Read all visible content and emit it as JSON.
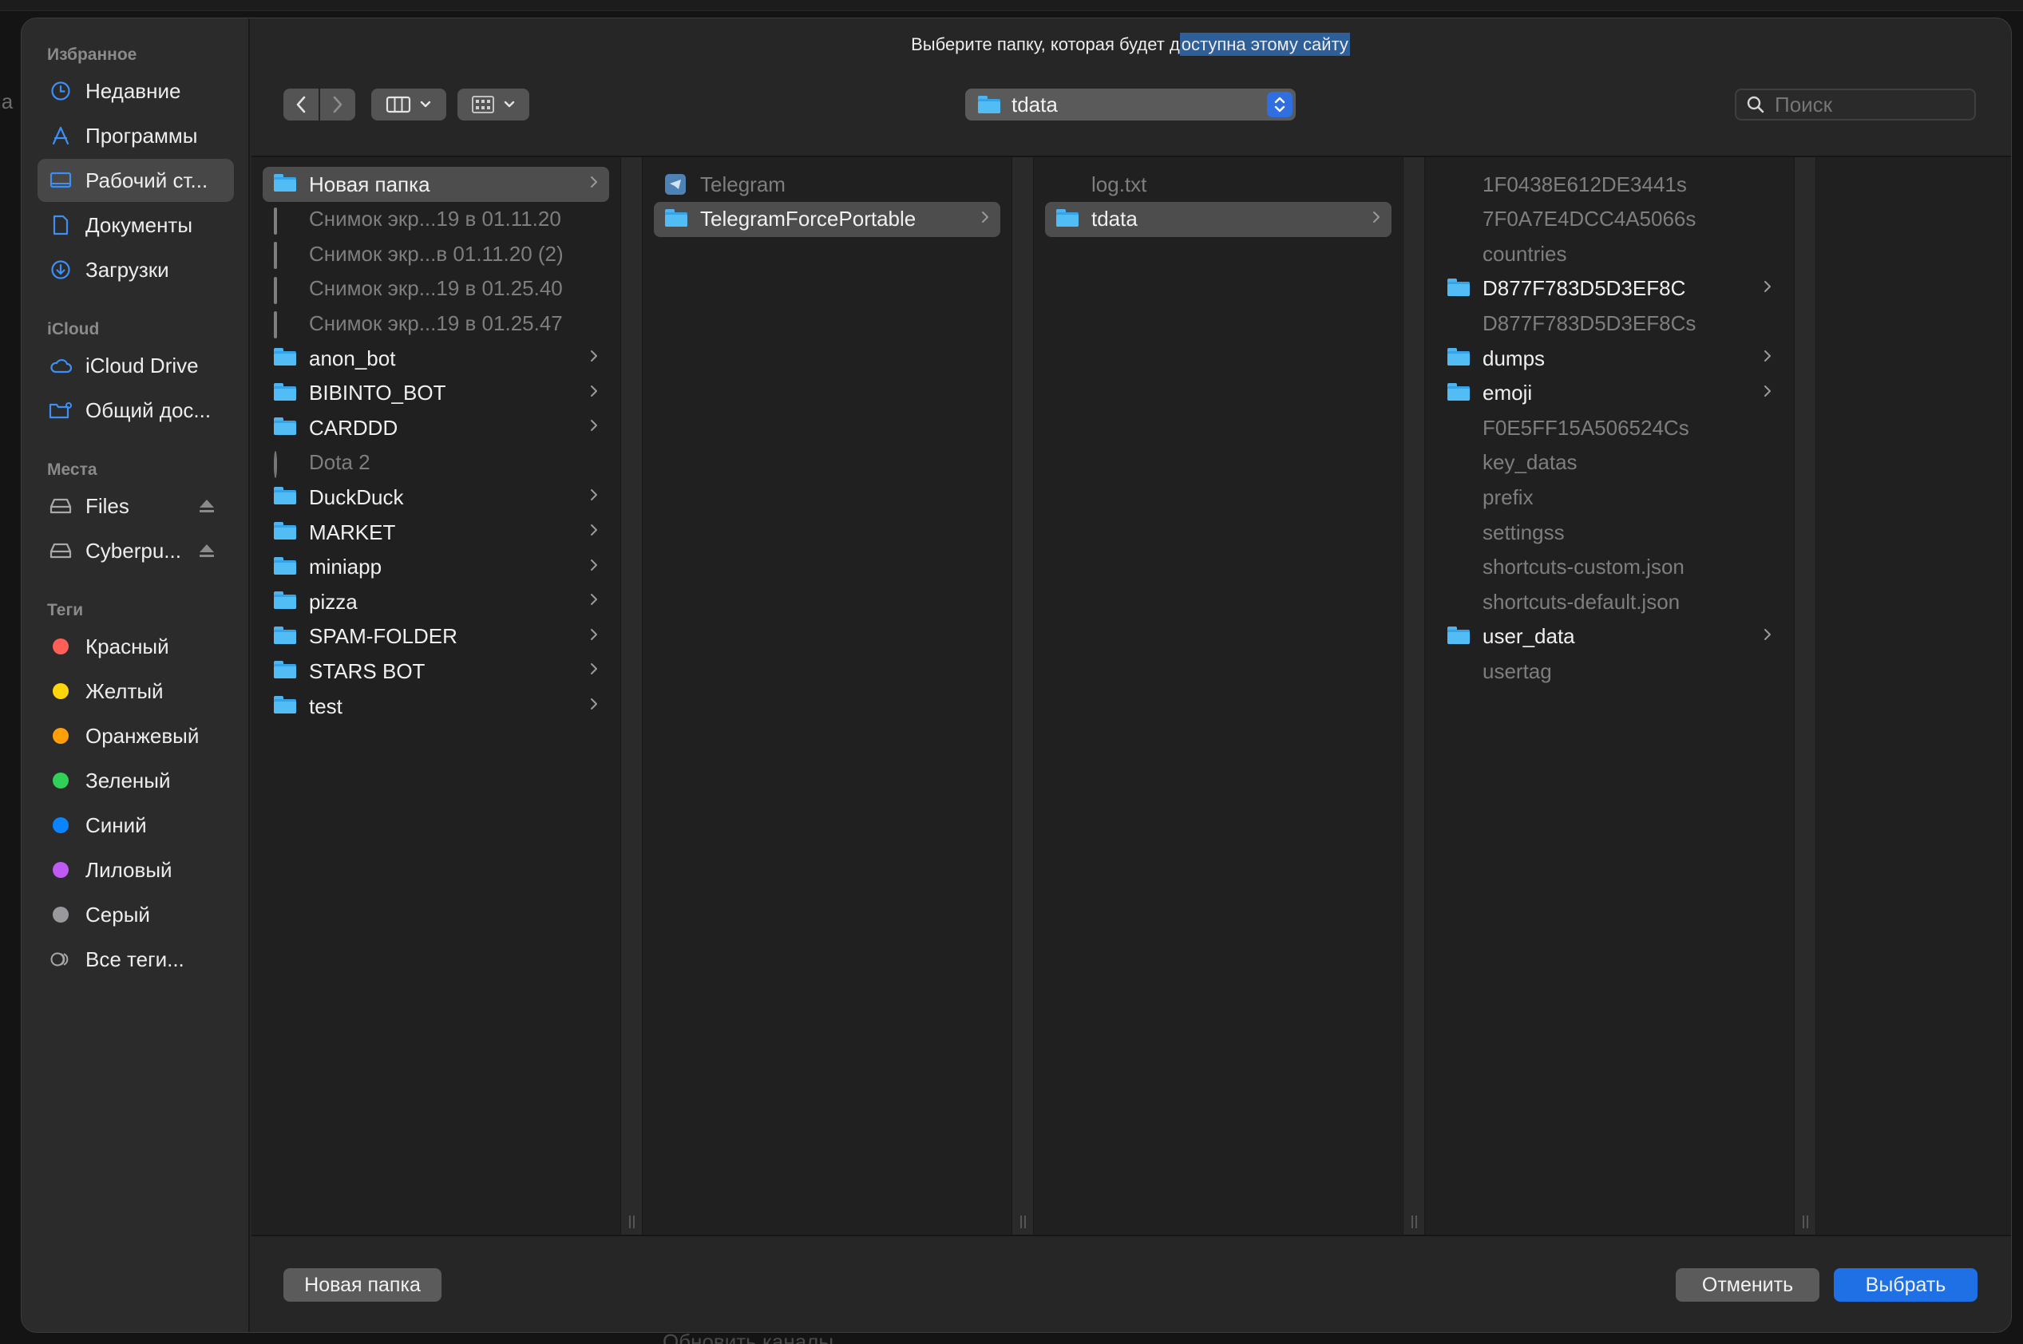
{
  "background": {
    "left_text": "la",
    "bottom_text": "Обновить каналы"
  },
  "dialog": {
    "title_prefix": "Выберите папку, которая будет д",
    "title_highlight": "оступна этому сайту"
  },
  "sidebar": {
    "favorites_heading": "Избранное",
    "favorites": [
      {
        "label": "Недавние",
        "icon": "clock-icon"
      },
      {
        "label": "Программы",
        "icon": "applications-icon"
      },
      {
        "label": "Рабочий ст...",
        "icon": "desktop-icon",
        "selected": true
      },
      {
        "label": "Документы",
        "icon": "document-icon"
      },
      {
        "label": "Загрузки",
        "icon": "download-icon"
      }
    ],
    "icloud_heading": "iCloud",
    "icloud": [
      {
        "label": "iCloud Drive",
        "icon": "cloud-icon"
      },
      {
        "label": "Общий дос...",
        "icon": "shared-folder-icon"
      }
    ],
    "places_heading": "Места",
    "places": [
      {
        "label": "Files",
        "icon": "drive-icon"
      },
      {
        "label": "Cyberpu...",
        "icon": "drive-icon"
      }
    ],
    "tags_heading": "Теги",
    "tags": [
      {
        "label": "Красный",
        "color": "#ff5f57"
      },
      {
        "label": "Желтый",
        "color": "#ffd60a"
      },
      {
        "label": "Оранжевый",
        "color": "#ff9f0a"
      },
      {
        "label": "Зеленый",
        "color": "#30d158"
      },
      {
        "label": "Синий",
        "color": "#0a84ff"
      },
      {
        "label": "Лиловый",
        "color": "#bf5af2"
      },
      {
        "label": "Серый",
        "color": "#98989d"
      }
    ],
    "all_tags": "Все теги..."
  },
  "toolbar": {
    "path": "tdata",
    "search_placeholder": "Поиск"
  },
  "columns": {
    "col1": [
      {
        "name": "Новая папка",
        "kind": "folder",
        "selected": true
      },
      {
        "name": "Снимок экр...19 в 01.11.20",
        "kind": "screenshot",
        "dim": true
      },
      {
        "name": "Снимок экр...в 01.11.20 (2)",
        "kind": "screenshot",
        "dim": true
      },
      {
        "name": "Снимок экр...19 в 01.25.40",
        "kind": "screenshot-plain",
        "dim": true
      },
      {
        "name": "Снимок экр...19 в 01.25.47",
        "kind": "screenshot-plain",
        "dim": true
      },
      {
        "name": "anon_bot",
        "kind": "folder"
      },
      {
        "name": "BIBINTO_BOT",
        "kind": "folder"
      },
      {
        "name": "CARDDD",
        "kind": "folder"
      },
      {
        "name": "Dota 2",
        "kind": "app",
        "dim": true
      },
      {
        "name": "DuckDuck",
        "kind": "folder"
      },
      {
        "name": "MARKET",
        "kind": "folder"
      },
      {
        "name": "miniapp",
        "kind": "folder"
      },
      {
        "name": "pizza",
        "kind": "folder"
      },
      {
        "name": "SPAM-FOLDER",
        "kind": "folder"
      },
      {
        "name": "STARS BOT",
        "kind": "folder"
      },
      {
        "name": "test",
        "kind": "folder"
      }
    ],
    "col2": [
      {
        "name": "Telegram",
        "kind": "telegram-app",
        "dim": true
      },
      {
        "name": "TelegramForcePortable",
        "kind": "folder",
        "selected": true
      }
    ],
    "col3": [
      {
        "name": "log.txt",
        "kind": "file",
        "dim": true
      },
      {
        "name": "tdata",
        "kind": "folder",
        "selected": true
      }
    ],
    "col4": [
      {
        "name": "1F0438E612DE3441s",
        "kind": "file",
        "dim": true
      },
      {
        "name": "7F0A7E4DCC4A5066s",
        "kind": "file",
        "dim": true
      },
      {
        "name": "countries",
        "kind": "file",
        "dim": true
      },
      {
        "name": "D877F783D5D3EF8C",
        "kind": "folder"
      },
      {
        "name": "D877F783D5D3EF8Cs",
        "kind": "file",
        "dim": true
      },
      {
        "name": "dumps",
        "kind": "folder"
      },
      {
        "name": "emoji",
        "kind": "folder"
      },
      {
        "name": "F0E5FF15A506524Cs",
        "kind": "file",
        "dim": true
      },
      {
        "name": "key_datas",
        "kind": "file",
        "dim": true
      },
      {
        "name": "prefix",
        "kind": "file",
        "dim": true
      },
      {
        "name": "settingss",
        "kind": "file",
        "dim": true
      },
      {
        "name": "shortcuts-custom.json",
        "kind": "json",
        "dim": true
      },
      {
        "name": "shortcuts-default.json",
        "kind": "json",
        "dim": true
      },
      {
        "name": "user_data",
        "kind": "folder"
      },
      {
        "name": "usertag",
        "kind": "file",
        "dim": true
      }
    ]
  },
  "footer": {
    "new_folder": "Новая папка",
    "cancel": "Отменить",
    "choose": "Выбрать"
  }
}
